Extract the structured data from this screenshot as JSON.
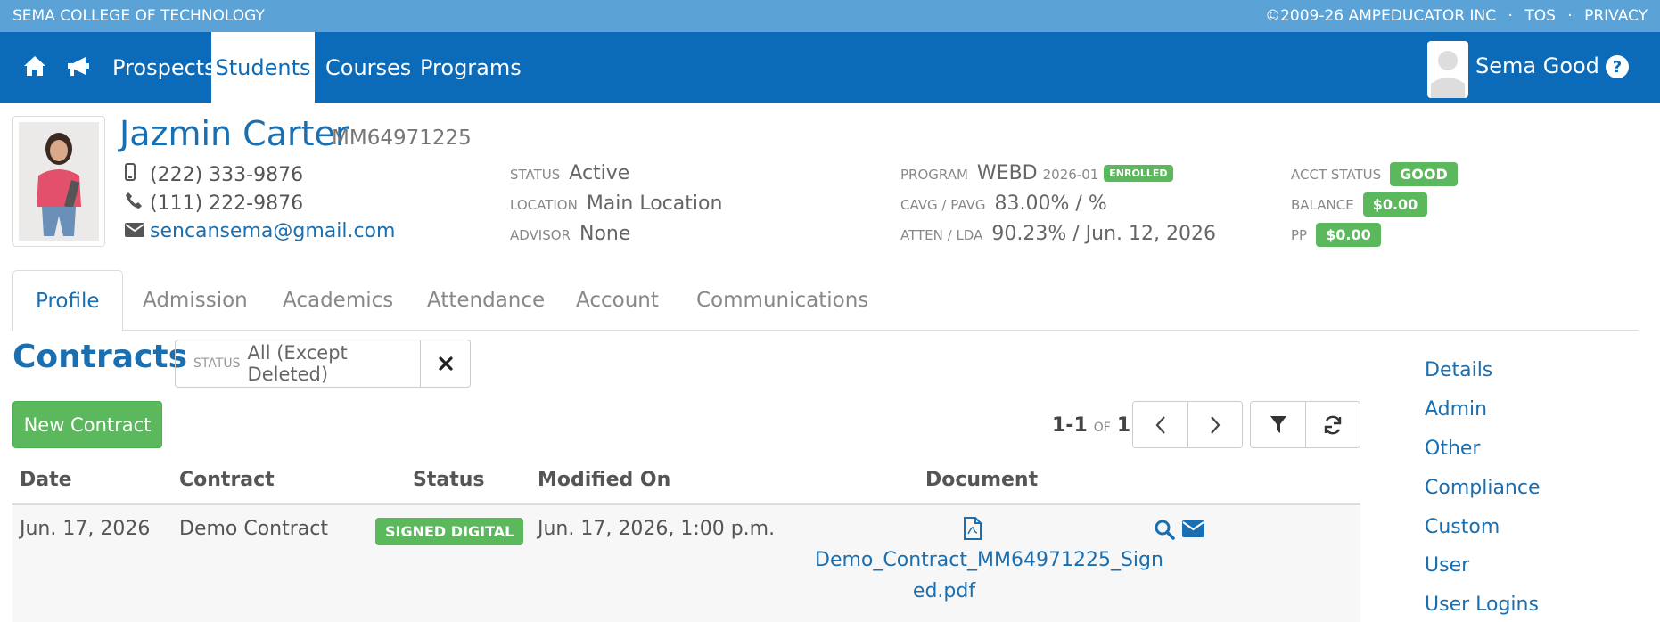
{
  "topbar": {
    "school": "SEMA COLLEGE OF TECHNOLOGY",
    "copyright": "©2009-26 AMPEDUCATOR INC",
    "sep": "·",
    "tos": "TOS",
    "privacy": "PRIVACY"
  },
  "nav": {
    "items": [
      "Prospects",
      "Students",
      "Courses",
      "Programs"
    ],
    "active": "Students",
    "user": "Sema Good",
    "help": "?"
  },
  "student": {
    "name": "Jazmin Carter",
    "id": "MM64971225",
    "mobile": "(222) 333-9876",
    "phone": "(111) 222-9876",
    "email": "sencansema@gmail.com",
    "status_label": "STATUS",
    "status": "Active",
    "location_label": "LOCATION",
    "location": "Main Location",
    "advisor_label": "ADVISOR",
    "advisor": "None",
    "program_label": "PROGRAM",
    "program": "WEBD",
    "program_term": "2026-01",
    "program_badge": "ENROLLED",
    "cavg_label": "CAVG / PAVG",
    "cavg": "83.00% / %",
    "atten_label": "ATTEN / LDA",
    "atten": "90.23% / Jun. 12, 2026",
    "acct_label": "ACCT STATUS",
    "acct": "GOOD",
    "balance_label": "BALANCE",
    "balance": "$0.00",
    "pp_label": "PP",
    "pp": "$0.00"
  },
  "tabs": [
    "Profile",
    "Admission",
    "Academics",
    "Attendance",
    "Account",
    "Communications"
  ],
  "contracts": {
    "title": "Contracts",
    "filter_label": "STATUS",
    "filter_value": "All (Except Deleted)",
    "new_button": "New Contract",
    "pager_range": "1-1",
    "pager_of": "OF",
    "pager_total": "1",
    "columns": [
      "Date",
      "Contract",
      "Status",
      "Modified On",
      "Document"
    ],
    "rows": [
      {
        "date": "Jun. 17, 2026",
        "contract": "Demo Contract",
        "status": "SIGNED DIGITAL",
        "modified": "Jun. 17, 2026, 1:00 p.m.",
        "document_line1": "Demo_Contract_MM64971225_Sign",
        "document_line2": "ed.pdf"
      }
    ]
  },
  "side_links": [
    "Details",
    "Admin",
    "Other",
    "Compliance",
    "Custom",
    "User",
    "User Logins"
  ],
  "colors": {
    "topstrip": "#5ba3d6",
    "nav": "#0b6bb8",
    "link": "#1a6fb0",
    "success": "#5cb85c"
  }
}
